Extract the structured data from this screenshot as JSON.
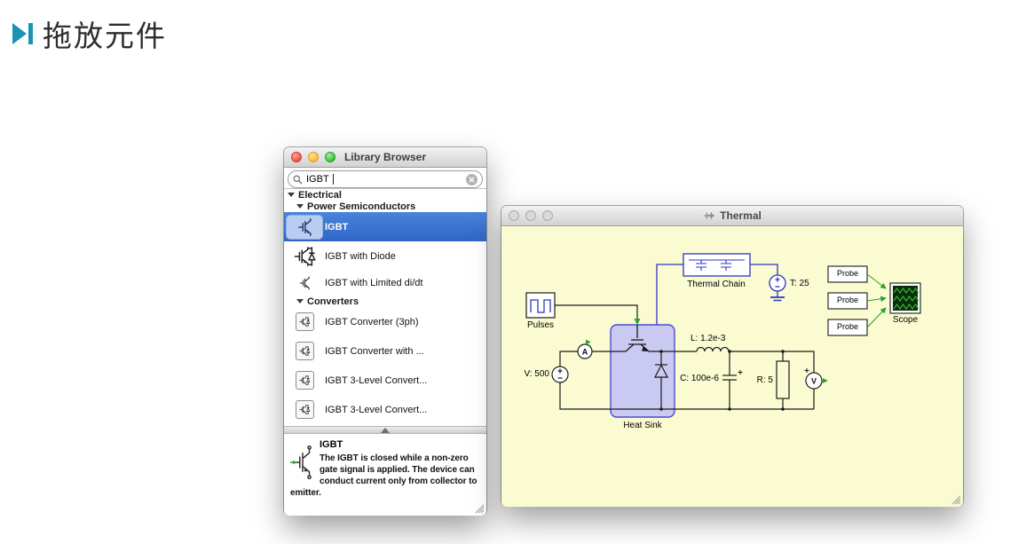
{
  "header": {
    "title": "拖放元件"
  },
  "library_browser": {
    "window_title": "Library Browser",
    "search": {
      "value": "IGBT"
    },
    "tree": {
      "sections": {
        "electrical": "Electrical",
        "power_semiconductors": "Power Semiconductors",
        "converters": "Converters"
      },
      "items": [
        {
          "label": "IGBT",
          "selected": true
        },
        {
          "label": "IGBT with Diode",
          "selected": false
        },
        {
          "label": "IGBT with Limited di/dt",
          "selected": false
        }
      ],
      "converter_items": [
        {
          "label": "IGBT Converter (3ph)"
        },
        {
          "label": "IGBT Converter with ..."
        },
        {
          "label": "IGBT 3-Level Convert..."
        },
        {
          "label": "IGBT 3-Level Convert..."
        }
      ]
    },
    "description": {
      "title": "IGBT",
      "text": "The IGBT is closed while a non-zero gate signal is applied. The device can conduct current only from collector to emitter."
    }
  },
  "schematic": {
    "window_title": "Thermal",
    "labels": {
      "pulses": "Pulses",
      "voltage_source": "V: 500",
      "ammeter": "A",
      "heat_sink": "Heat Sink",
      "thermal_chain": "Thermal Chain",
      "temperature": "T: 25",
      "inductor": "L: 1.2e-3",
      "capacitor": "C: 100e-6",
      "resistor": "R: 5",
      "voltmeter": "V",
      "probe1": "Probe",
      "probe2": "Probe",
      "probe3": "Probe",
      "scope": "Scope"
    }
  },
  "colors": {
    "selection_blue": "#3c76d3",
    "canvas_yellow": "#fbfbd2",
    "heat_sink_fill": "#c9c9f2",
    "thermal_blue": "#2b35c0",
    "signal_green": "#2ba12b",
    "accent_teal": "#1a93b4"
  }
}
